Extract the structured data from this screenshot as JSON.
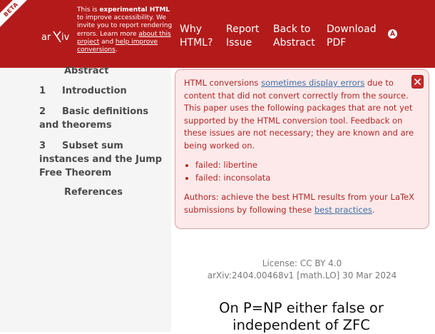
{
  "header": {
    "beta_label": "BETA",
    "logo_text": "arXiv",
    "notice": {
      "pre": "This is ",
      "bold": "experimental HTML",
      "mid": " to improve accessibility. We invite you to report rendering errors. Learn more ",
      "link1": "about this project",
      "and": " and ",
      "link2": "help improve conversions",
      "end": "."
    },
    "nav": {
      "why_html": [
        "Why",
        "HTML?"
      ],
      "report_issue": [
        "Report",
        "Issue"
      ],
      "back_to_abstract": [
        "Back to",
        "Abstract"
      ],
      "download_pdf": [
        "Download",
        "PDF"
      ]
    },
    "colors": {
      "brand": "#b31b1b",
      "text": "#ffffff"
    }
  },
  "sidebar": {
    "items": [
      {
        "num": "",
        "label": "Abstract"
      },
      {
        "num": "1",
        "label": "Introduction"
      },
      {
        "num": "2",
        "label": "Basic definitions and theorems"
      },
      {
        "num": "3",
        "label": "Subset sum instances and the Jump Free Theorem"
      },
      {
        "num": "",
        "label": "References"
      }
    ]
  },
  "alert": {
    "intro_pre": "HTML conversions ",
    "intro_link": "sometimes display errors",
    "intro_post": " due to content that did not convert correctly from the source. This paper uses the following packages that are not yet supported by the HTML conversion tool. Feedback on these issues are not necessary; they are known and are being worked on.",
    "failures": [
      "failed: libertine",
      "failed: inconsolata"
    ],
    "outro_pre": "Authors: achieve the best HTML results from your LaTeX submissions by following these ",
    "outro_link": "best practices",
    "outro_post": ".",
    "close_icon": "close-icon",
    "colors": {
      "background": "#fde9e9",
      "text": "#b32626",
      "link": "#3b70a8",
      "close": "#c62b2b"
    }
  },
  "paper": {
    "license": "License: CC BY 4.0",
    "arxiv_id": "arXiv:2404.00468v1 [math.LO] 30 Mar 2024",
    "title": "On P=NP either false or independent of ZFC"
  }
}
